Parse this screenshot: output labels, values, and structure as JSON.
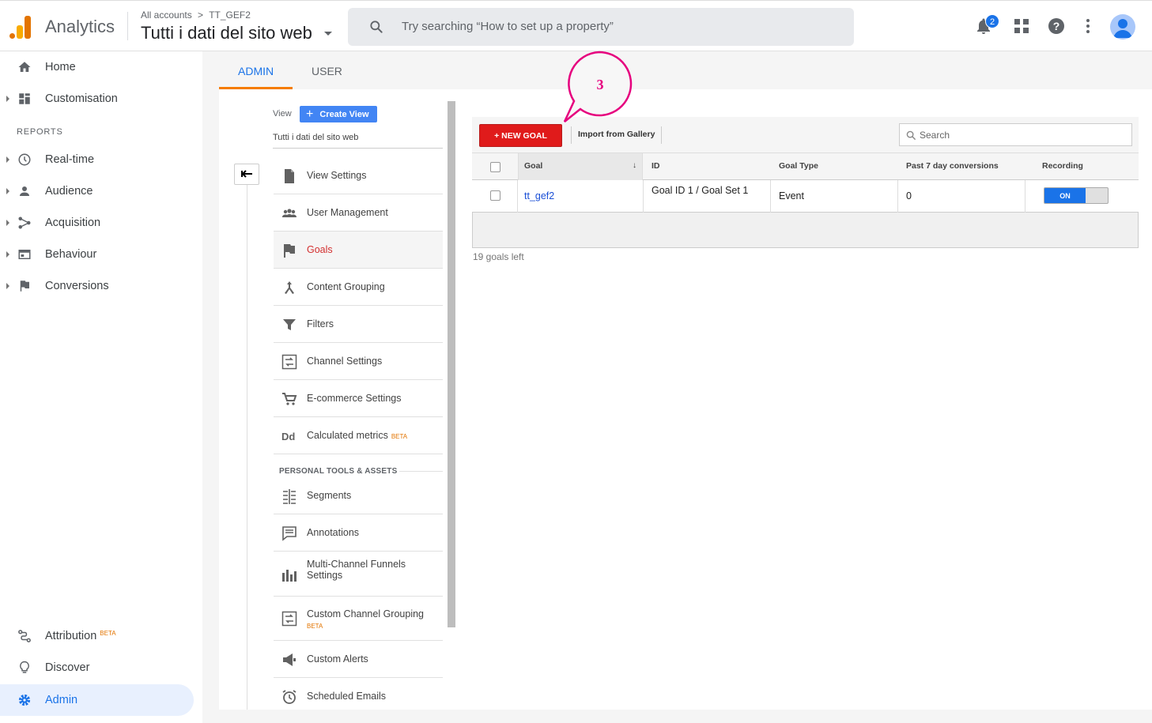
{
  "topbar": {
    "app_name": "Analytics",
    "breadcrumb_all": "All accounts",
    "breadcrumb_arrow": ">",
    "breadcrumb_account": "TT_GEF2",
    "property_name": "Tutti i dati del sito web",
    "search_placeholder": "Try searching “How to set up a property”",
    "notification_count": "2"
  },
  "leftnav": {
    "home": "Home",
    "customisation": "Customisation",
    "reports_header": "REPORTS",
    "realtime": "Real-time",
    "audience": "Audience",
    "acquisition": "Acquisition",
    "behaviour": "Behaviour",
    "conversions": "Conversions",
    "attribution": "Attribution",
    "attribution_beta": "BETA",
    "discover": "Discover",
    "admin": "Admin"
  },
  "tabs": {
    "admin": "ADMIN",
    "user": "USER"
  },
  "view_column": {
    "view_label": "View",
    "create_view": "Create View",
    "view_name": "Tutti i dati del sito web",
    "items": [
      {
        "label": "View Settings"
      },
      {
        "label": "User Management"
      },
      {
        "label": "Goals"
      },
      {
        "label": "Content Grouping"
      },
      {
        "label": "Filters"
      },
      {
        "label": "Channel Settings"
      },
      {
        "label": "E-commerce Settings"
      },
      {
        "label": "Calculated metrics",
        "badge": "BETA"
      }
    ],
    "personal_section": "PERSONAL TOOLS & ASSETS",
    "personal_items": [
      {
        "label": "Segments"
      },
      {
        "label": "Annotations"
      },
      {
        "label": "Multi-Channel Funnels Settings"
      },
      {
        "label": "Custom Channel Grouping",
        "badge": "BETA"
      },
      {
        "label": "Custom Alerts"
      },
      {
        "label": "Scheduled Emails"
      }
    ]
  },
  "goals": {
    "new_goal": "+ NEW GOAL",
    "import_gallery": "Import from Gallery",
    "search_placeholder": "Search",
    "columns": [
      "Goal",
      "ID",
      "Goal Type",
      "Past 7 day conversions",
      "Recording"
    ],
    "rows": [
      {
        "goal": "tt_gef2",
        "id": "Goal ID 1 / Goal Set 1",
        "type": "Event",
        "conversions": "0",
        "recording": "ON"
      }
    ],
    "goals_left": "19 goals left"
  },
  "callout": {
    "number": "3"
  },
  "colors": {
    "accent_blue": "#1a73e8",
    "new_goal_red": "#e01b1b",
    "callout_pink": "#e6007e",
    "tab_orange": "#f57c00"
  }
}
